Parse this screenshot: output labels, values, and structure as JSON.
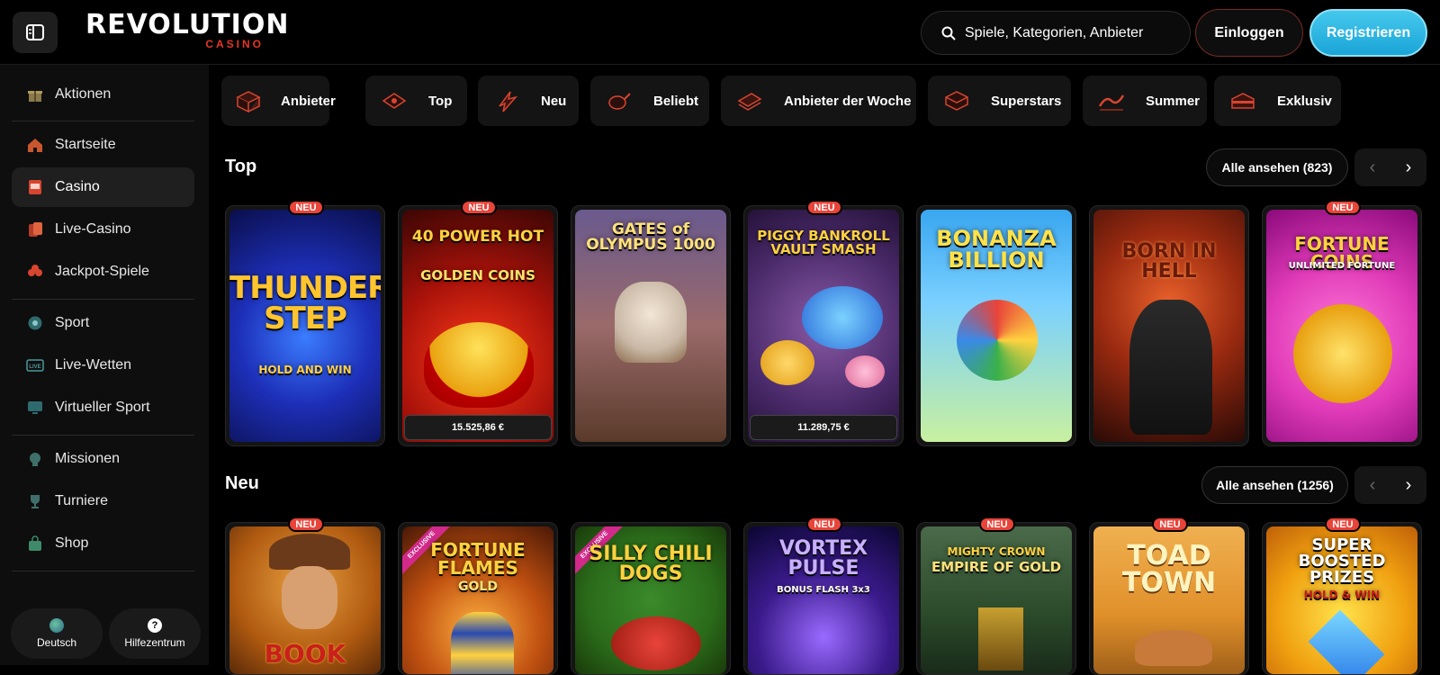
{
  "header": {
    "logo_text": "REVOLUTION",
    "logo_sub": "CASINO",
    "search_placeholder": "Spiele, Kategorien, Anbieter",
    "login_label": "Einloggen",
    "register_label": "Registrieren"
  },
  "sidebar": {
    "items": [
      {
        "label": "Aktionen",
        "icon": "gift-icon"
      },
      {
        "label": "Startseite",
        "icon": "home-icon"
      },
      {
        "label": "Casino",
        "icon": "slot-machine-icon"
      },
      {
        "label": "Live-Casino",
        "icon": "cards-icon"
      },
      {
        "label": "Jackpot-Spiele",
        "icon": "clover-icon"
      },
      {
        "label": "Sport",
        "icon": "ball-icon"
      },
      {
        "label": "Live-Wetten",
        "icon": "live-icon"
      },
      {
        "label": "Virtueller Sport",
        "icon": "monitor-icon"
      },
      {
        "label": "Missionen",
        "icon": "medal-icon"
      },
      {
        "label": "Turniere",
        "icon": "trophy-icon"
      },
      {
        "label": "Shop",
        "icon": "bag-icon"
      }
    ],
    "active": "Casino",
    "language_label": "Deutsch",
    "help_label": "Hilfezentrum"
  },
  "categories": [
    {
      "label": "Anbieter",
      "icon": "box-icon"
    },
    {
      "label": "Top",
      "icon": "ticket-icon"
    },
    {
      "label": "Neu",
      "icon": "lightning-icon"
    },
    {
      "label": "Beliebt",
      "icon": "chicken-icon"
    },
    {
      "label": "Anbieter der Woche",
      "icon": "stack-icon"
    },
    {
      "label": "Superstars",
      "icon": "diamond-box-icon"
    },
    {
      "label": "Summer",
      "icon": "wave-icon"
    },
    {
      "label": "Exklusiv",
      "icon": "treasure-icon"
    }
  ],
  "sections": {
    "top": {
      "title": "Top",
      "see_all": "Alle ansehen (823)",
      "games": [
        {
          "title": "THUNDER STEP",
          "sub": "HOLD AND WIN",
          "badge": "NEU"
        },
        {
          "title": "40 POWER HOT",
          "sub": "GOLDEN COINS",
          "badge": "NEU",
          "jackpot": "15.525,86 €"
        },
        {
          "title": "GATES of OLYMPUS 1000",
          "sub": ""
        },
        {
          "title": "PIGGY BANKROLL VAULT SMASH",
          "sub": "",
          "badge": "NEU",
          "jackpot": "11.289,75 €"
        },
        {
          "title": "BONANZA BILLION",
          "sub": ""
        },
        {
          "title": "BORN IN HELL",
          "sub": ""
        },
        {
          "title": "FORTUNE COINS",
          "sub": "UNLIMITED FORTUNE",
          "badge": "NEU"
        }
      ]
    },
    "new": {
      "title": "Neu",
      "see_all": "Alle ansehen (1256)",
      "games": [
        {
          "title": "BOOK",
          "badge": "NEU"
        },
        {
          "title": "FORTUNE FLAMES",
          "sub": "GOLD",
          "ribbon": "EXCLUSIVE"
        },
        {
          "title": "SILLY CHILI DOGS",
          "ribbon": "EXCLUSIVE"
        },
        {
          "title": "VORTEX PULSE",
          "sub": "BONUS FLASH 3x3",
          "badge": "NEU"
        },
        {
          "title": "MIGHTY CROWN",
          "sub": "EMPIRE OF GOLD",
          "badge": "NEU"
        },
        {
          "title": "TOAD TOWN",
          "badge": "NEU"
        },
        {
          "title": "SUPER BOOSTED PRIZES",
          "sub": "HOLD & WIN",
          "badge": "NEU"
        }
      ]
    }
  },
  "colors": {
    "accent": "#e8443a",
    "register": "#2bb8e3",
    "background": "#000000",
    "sidebar": "#0e0e0e"
  }
}
